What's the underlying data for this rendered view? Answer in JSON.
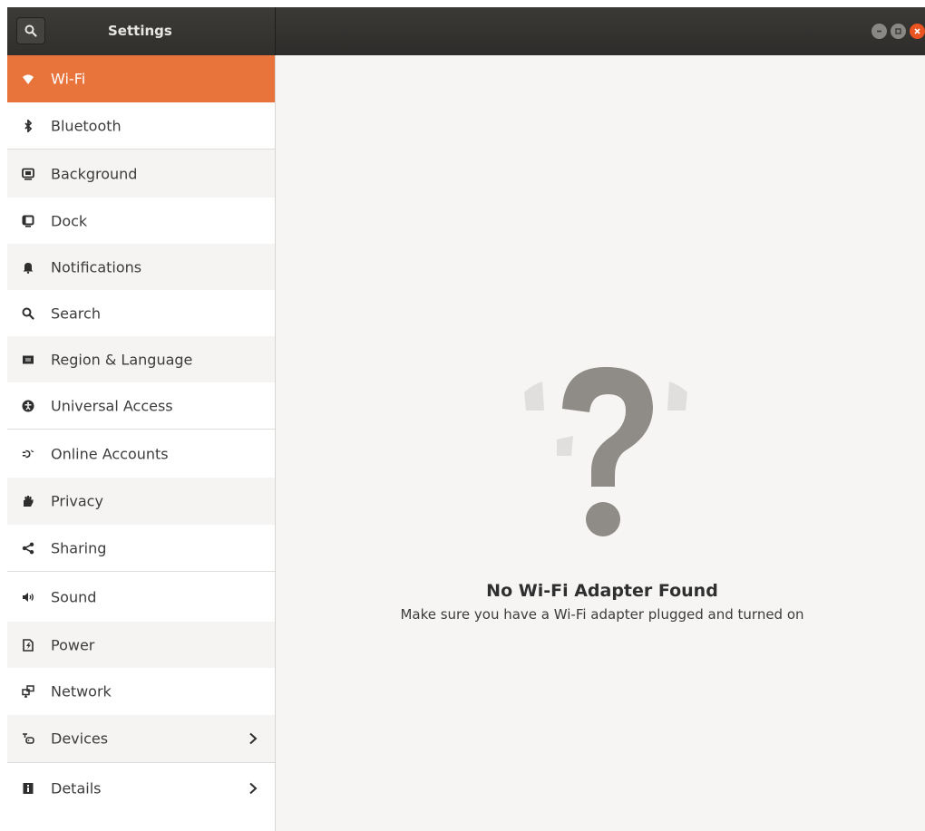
{
  "header": {
    "title": "Settings",
    "search_icon": "search-icon"
  },
  "window_controls": {
    "minimize_icon": "minimize-icon",
    "maximize_icon": "maximize-icon",
    "close_icon": "close-icon"
  },
  "sidebar": {
    "items": [
      {
        "label": "Wi-Fi",
        "icon": "wifi-icon",
        "selected": true
      },
      {
        "label": "Bluetooth",
        "icon": "bluetooth-icon"
      },
      {
        "label": "Background",
        "icon": "background-icon"
      },
      {
        "label": "Dock",
        "icon": "dock-icon"
      },
      {
        "label": "Notifications",
        "icon": "bell-icon"
      },
      {
        "label": "Search",
        "icon": "search-icon"
      },
      {
        "label": "Region & Language",
        "icon": "flag-icon"
      },
      {
        "label": "Universal Access",
        "icon": "accessibility-icon"
      },
      {
        "label": "Online Accounts",
        "icon": "online-accounts-icon"
      },
      {
        "label": "Privacy",
        "icon": "privacy-hand-icon"
      },
      {
        "label": "Sharing",
        "icon": "share-icon"
      },
      {
        "label": "Sound",
        "icon": "speaker-icon"
      },
      {
        "label": "Power",
        "icon": "power-icon"
      },
      {
        "label": "Network",
        "icon": "network-icon"
      },
      {
        "label": "Devices",
        "icon": "devices-icon",
        "chevron": true
      },
      {
        "label": "Details",
        "icon": "info-icon",
        "chevron": true
      }
    ]
  },
  "content": {
    "icon": "question-mark-icon",
    "title": "No Wi-Fi Adapter Found",
    "subtitle": "Make sure you have a Wi-Fi adapter plugged and turned on"
  },
  "colors": {
    "accent": "#e8743b",
    "headerbar": "#302f2c",
    "content_bg": "#f6f5f4",
    "close_button": "#e95420"
  }
}
